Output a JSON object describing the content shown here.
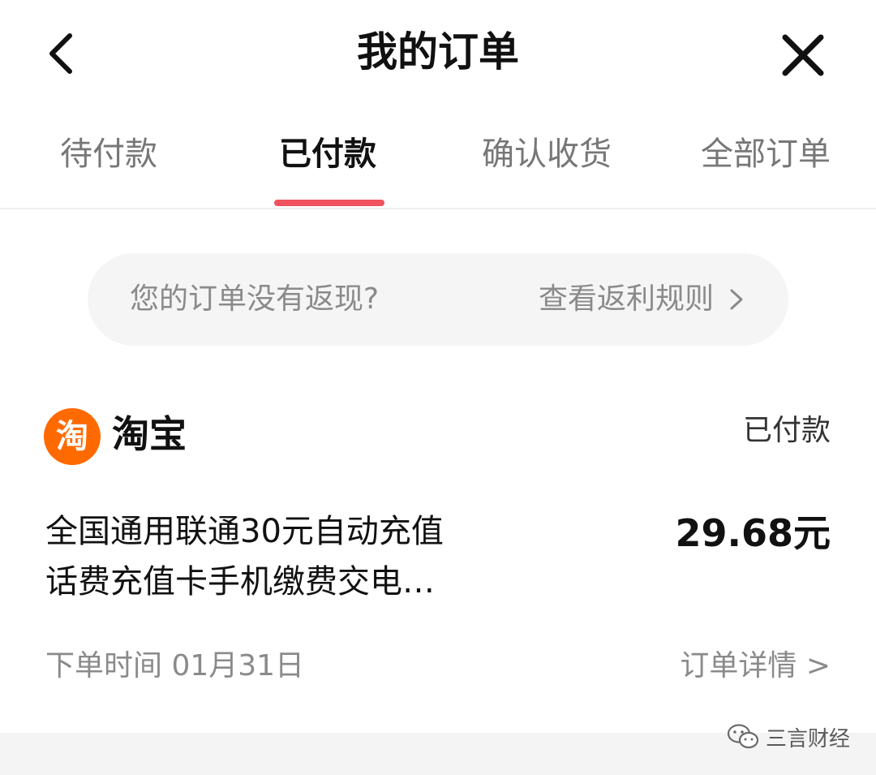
{
  "header": {
    "title": "我的订单",
    "back_icon": "chevron-left-icon",
    "close_icon": "close-icon"
  },
  "tabs": [
    {
      "label": "待付款",
      "active": false
    },
    {
      "label": "已付款",
      "active": true
    },
    {
      "label": "确认收货",
      "active": false
    },
    {
      "label": "全部订单",
      "active": false
    }
  ],
  "accent_color": "#f0535f",
  "rebate_banner": {
    "question": "您的订单没有返现?",
    "link": "查看返利规则"
  },
  "order": {
    "shop_logo_text": "淘",
    "shop_logo_color": "#ff6a00",
    "shop_name": "淘宝",
    "status": "已付款",
    "product_title_line1": "全国通用联通30元自动充值",
    "product_title_line2": "话费充值卡手机缴费交电…",
    "price": "29.68元",
    "order_time": "下单时间 01月31日",
    "detail_link": "订单详情 >"
  },
  "watermark": {
    "text": "三言财经",
    "icon": "wechat-icon"
  }
}
